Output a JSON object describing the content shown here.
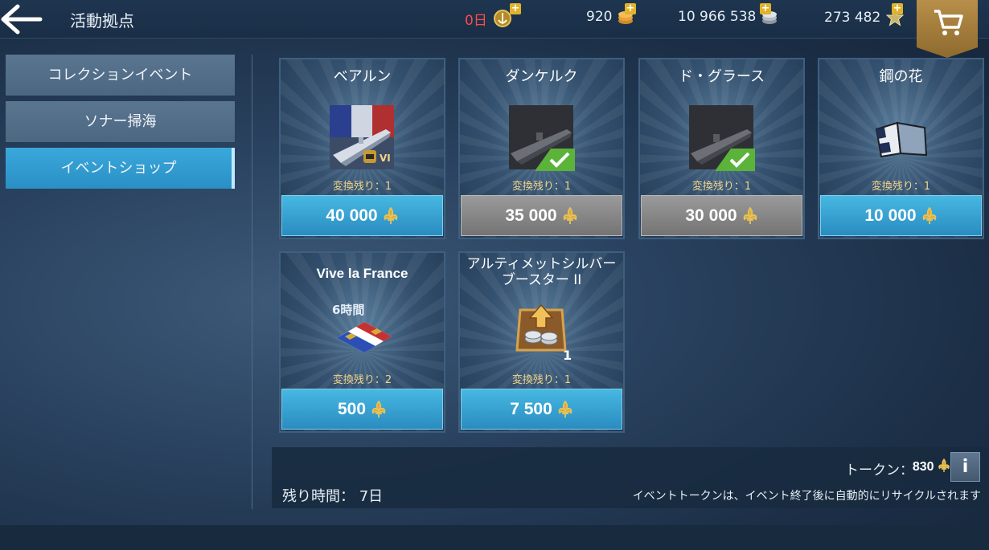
{
  "header": {
    "back_icon": "arrow-left-icon",
    "title": "活動拠点",
    "resources": [
      {
        "value": "0日",
        "icon": "premium-anchor-icon",
        "color": "#ff4b4b"
      },
      {
        "value": "920",
        "icon": "gold-coins-icon",
        "color": "#e6edf4"
      },
      {
        "value": "10 966 538",
        "icon": "silver-coins-icon",
        "color": "#e6edf4"
      },
      {
        "value": "273 482",
        "icon": "free-xp-star-icon",
        "color": "#e6edf4"
      }
    ],
    "cart_icon": "shopping-cart-icon"
  },
  "sidebar": {
    "items": [
      {
        "label": "コレクションイベント",
        "active": false
      },
      {
        "label": "ソナー掃海",
        "active": false
      },
      {
        "label": "イベントショップ",
        "active": true
      }
    ]
  },
  "shop": {
    "items": [
      {
        "name": "ベアルン",
        "remaining": "変換残り：1",
        "price": "40 000",
        "owned": false,
        "tier": "VI"
      },
      {
        "name": "ダンケルク",
        "remaining": "変換残り：1",
        "price": "35 000",
        "owned": true
      },
      {
        "name": "ド・グラース",
        "remaining": "変換残り：1",
        "price": "30 000",
        "owned": true
      },
      {
        "name": "鋼の花",
        "remaining": "変換残り：1",
        "price": "10 000",
        "owned": false
      },
      {
        "name": "Vive la France",
        "remaining": "変換残り：2",
        "price": "500",
        "owned": false,
        "duration": "6時間"
      },
      {
        "name": "アルティメットシルバーブースター II",
        "remaining": "変換残り：1",
        "price": "7 500",
        "owned": false,
        "quantity": "1"
      }
    ],
    "token_icon": "fleur-de-lis-icon"
  },
  "footer": {
    "token_label": "トークン：",
    "token_value": "830",
    "time_left": "残り時間：  7日",
    "recycle_note": "イベントトークンは、イベント終了後に自動的にリサイクルされます",
    "info_label": "i"
  },
  "colors": {
    "accent": "#2a8cc0",
    "owned_gray": "#8a8a8a",
    "check_green": "#5bb33a",
    "remaining_text": "#f2d58a",
    "cart_gold": "#a77f3e"
  }
}
